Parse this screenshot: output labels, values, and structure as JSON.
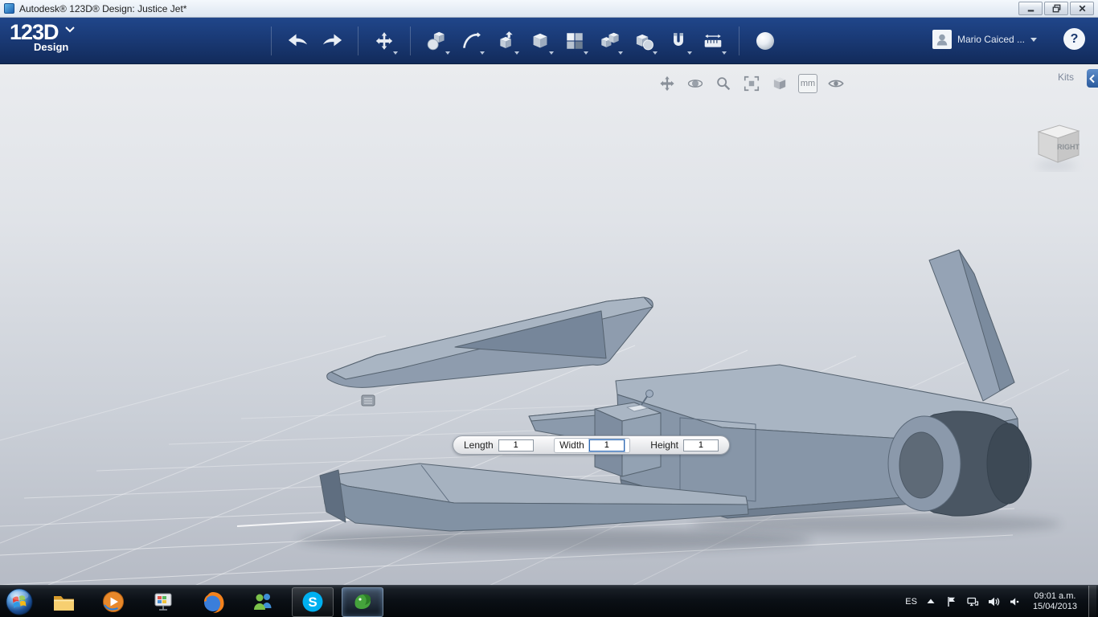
{
  "window": {
    "title": "Autodesk® 123D® Design: Justice Jet*"
  },
  "brand": {
    "logo": "123D",
    "sub": "Design"
  },
  "toolbar": {
    "user_name": "Mario Caiced ...",
    "help_label": "?",
    "icons": [
      "undo",
      "redo",
      "transform",
      "primitives",
      "sketch",
      "construct",
      "modify",
      "pattern",
      "grouping",
      "combine",
      "snap",
      "measure",
      "materials"
    ]
  },
  "nav": {
    "units_label": "mm",
    "icons": [
      "pan",
      "orbit",
      "zoom",
      "fit",
      "standard-views",
      "units",
      "visibility"
    ]
  },
  "panel": {
    "kits_label": "Kits"
  },
  "viewcube": {
    "face_label": "RIGHT"
  },
  "dims": {
    "length_label": "Length",
    "length_value": "1",
    "width_label": "Width",
    "width_value": "1",
    "height_label": "Height",
    "height_value": "1"
  },
  "taskbar": {
    "language": "ES",
    "skype_letter": "S"
  },
  "tray": {
    "time": "09:01 a.m.",
    "date": "15/04/2013"
  },
  "colors": {
    "toolbar_blue": "#1a3a76",
    "accent_blue": "#2f69b3",
    "model_gray": "#8d9bad",
    "viewport_top": "#eaecef",
    "viewport_bottom": "#b6bbc5",
    "taskbar_black": "#0b1016"
  }
}
